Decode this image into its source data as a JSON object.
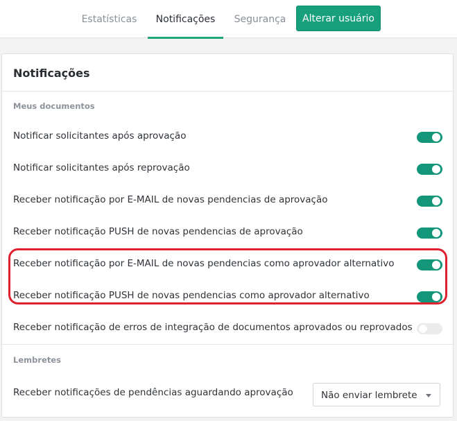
{
  "tabs": [
    {
      "label": "Estatísticas",
      "active": false
    },
    {
      "label": "Notificações",
      "active": true
    },
    {
      "label": "Segurança",
      "active": false
    }
  ],
  "header": {
    "change_user_button": "Alterar usuário"
  },
  "card": {
    "title": "Notificações",
    "sections": [
      {
        "label": "Meus documentos",
        "items": [
          {
            "label": "Notificar solicitantes após aprovação",
            "enabled": true
          },
          {
            "label": "Notificar solicitantes após reprovação",
            "enabled": true
          },
          {
            "label": "Receber notificação por E-MAIL de novas pendencias de aprovação",
            "enabled": true
          },
          {
            "label": "Receber notificação PUSH de novas pendencias de aprovação",
            "enabled": true
          },
          {
            "label": "Receber notificação por E-MAIL de novas pendencias como aprovador alternativo",
            "enabled": true
          },
          {
            "label": "Receber notificação PUSH de novas pendencias como aprovador alternativo",
            "enabled": true
          },
          {
            "label": "Receber notificação de erros de integração de documentos aprovados ou reprovados",
            "enabled": false
          }
        ]
      },
      {
        "label": "Lembretes",
        "items": [
          {
            "label": "Receber notificações de pendências aguardando aprovação",
            "selected_option": "Não enviar lembrete"
          }
        ]
      }
    ]
  },
  "colors": {
    "accent": "#17a07b",
    "highlight": "#e0202e",
    "toggle_off": "#ececec"
  }
}
